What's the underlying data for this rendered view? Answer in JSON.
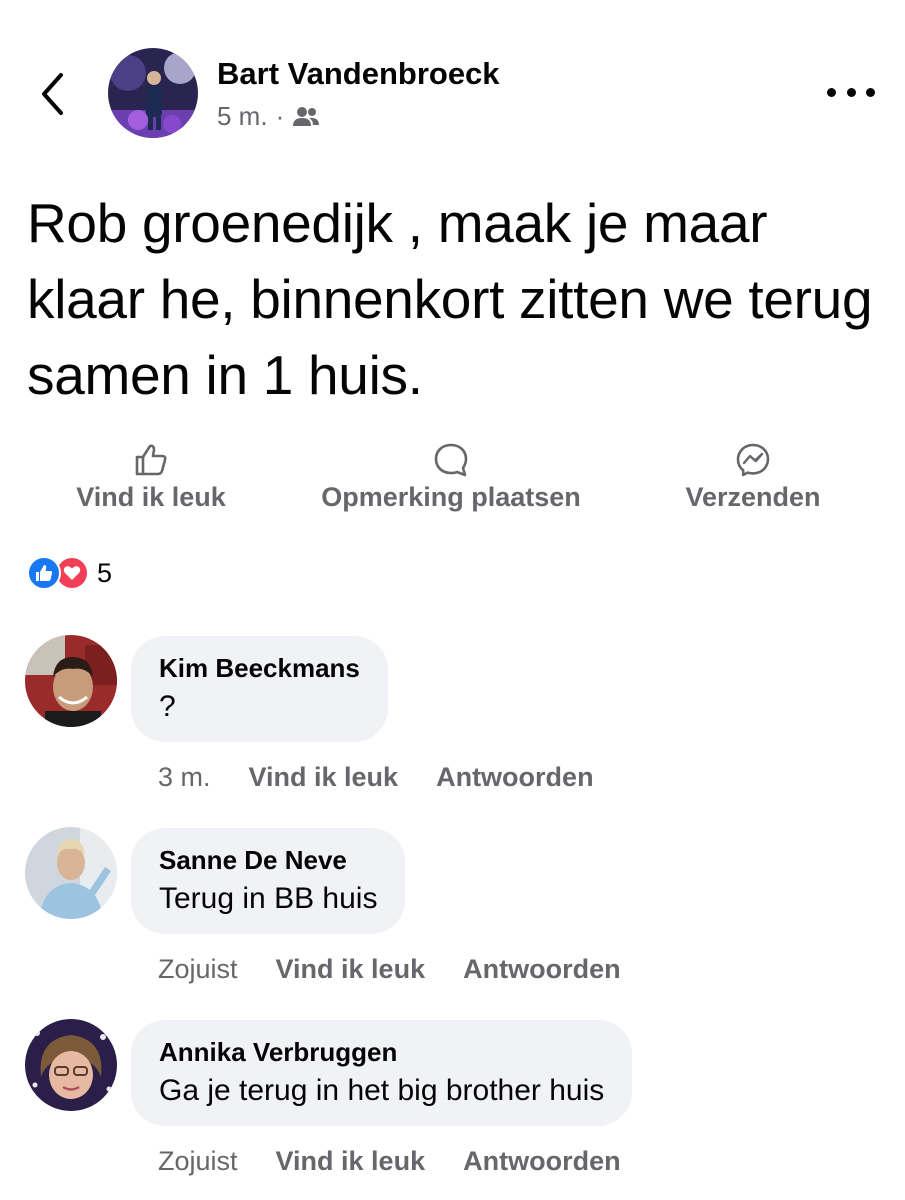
{
  "post": {
    "author": "Bart Vandenbroeck",
    "time": "5 m.",
    "separator": "·",
    "audience_icon": "friends-icon",
    "text": "Rob groenedijk , maak je maar klaar he, binnenkort zitten we terug samen in 1 huis."
  },
  "actions": {
    "like": "Vind ik leuk",
    "comment": "Opmerking plaatsen",
    "send": "Verzenden"
  },
  "reactions": {
    "count": "5",
    "types": [
      "like",
      "love"
    ]
  },
  "comments": [
    {
      "name": "Kim Beeckmans",
      "text": "?",
      "time": "3 m.",
      "like": "Vind ik leuk",
      "reply": "Antwoorden"
    },
    {
      "name": "Sanne De Neve",
      "text": "Terug in BB huis",
      "time": "Zojuist",
      "like": "Vind ik leuk",
      "reply": "Antwoorden"
    },
    {
      "name": "Annika Verbruggen",
      "text": "Ga je terug in het big brother huis",
      "time": "Zojuist",
      "like": "Vind ik leuk",
      "reply": "Antwoorden"
    }
  ],
  "colors": {
    "text": "#050505",
    "secondary": "#65676b",
    "bubble": "#f0f2f5",
    "like_blue": "#1877f2",
    "love_red": "#f33e58"
  }
}
